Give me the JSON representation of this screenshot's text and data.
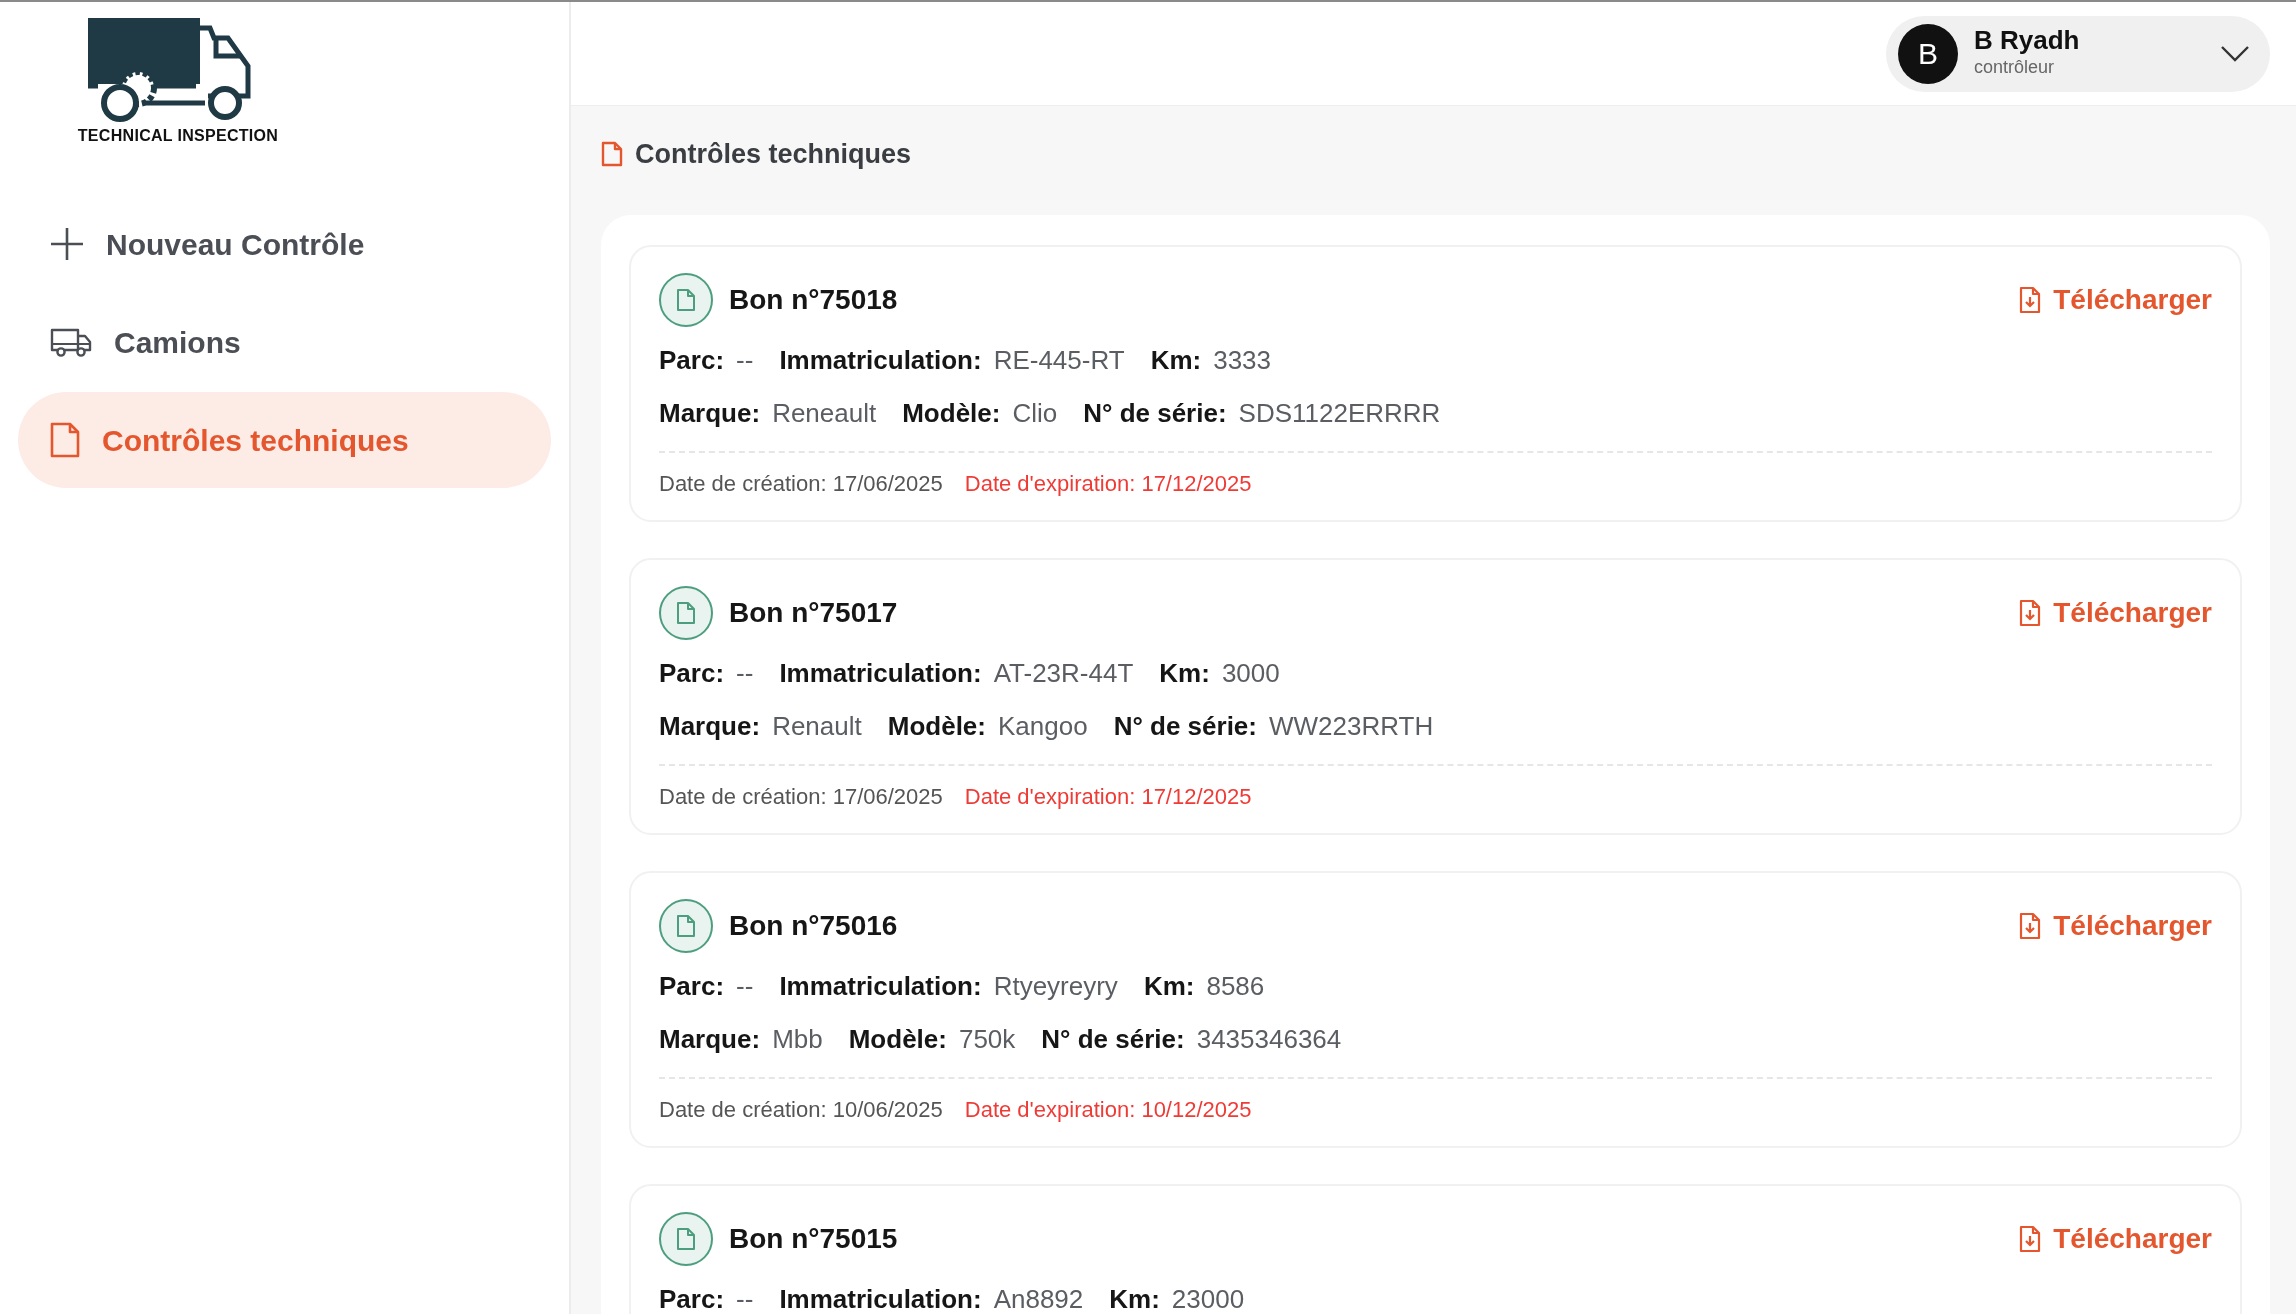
{
  "logo": {
    "text": "TECHNICAL INSPECTION"
  },
  "sidebar": {
    "items": [
      {
        "kind": "plus",
        "label": "Nouveau Contrôle",
        "selected": false
      },
      {
        "kind": "truck",
        "label": "Camions",
        "selected": false
      },
      {
        "kind": "document",
        "label": "Contrôles techniques",
        "selected": true
      }
    ]
  },
  "user": {
    "initial": "B",
    "name": "B Ryadh",
    "role": "contrôleur"
  },
  "page": {
    "title": "Contrôles techniques"
  },
  "bons": [
    {
      "title": "Bon n°75018",
      "download": "Télécharger",
      "rows": [
        [
          {
            "label": "Parc:",
            "value": "--"
          },
          {
            "label": "Immatriculation:",
            "value": "RE-445-RT"
          },
          {
            "label": "Km:",
            "value": "3333"
          }
        ],
        [
          {
            "label": "Marque:",
            "value": "Reneault"
          },
          {
            "label": "Modèle:",
            "value": "Clio"
          },
          {
            "label": "N° de série:",
            "value": "SDS1122ERRRR"
          }
        ]
      ],
      "created": "Date de création: 17/06/2025",
      "expires": "Date d'expiration: 17/12/2025"
    },
    {
      "title": "Bon n°75017",
      "download": "Télécharger",
      "rows": [
        [
          {
            "label": "Parc:",
            "value": "--"
          },
          {
            "label": "Immatriculation:",
            "value": "AT-23R-44T"
          },
          {
            "label": "Km:",
            "value": "3000"
          }
        ],
        [
          {
            "label": "Marque:",
            "value": "Renault"
          },
          {
            "label": "Modèle:",
            "value": "Kangoo"
          },
          {
            "label": "N° de série:",
            "value": "WW223RRTH"
          }
        ]
      ],
      "created": "Date de création: 17/06/2025",
      "expires": "Date d'expiration: 17/12/2025"
    },
    {
      "title": "Bon n°75016",
      "download": "Télécharger",
      "rows": [
        [
          {
            "label": "Parc:",
            "value": "--"
          },
          {
            "label": "Immatriculation:",
            "value": "Rtyeyreyry"
          },
          {
            "label": "Km:",
            "value": "8586"
          }
        ],
        [
          {
            "label": "Marque:",
            "value": "Mbb"
          },
          {
            "label": "Modèle:",
            "value": "750k"
          },
          {
            "label": "N° de série:",
            "value": "3435346364"
          }
        ]
      ],
      "created": "Date de création: 10/06/2025",
      "expires": "Date d'expiration: 10/12/2025"
    },
    {
      "title": "Bon n°75015",
      "download": "Télécharger",
      "rows": [
        [
          {
            "label": "Parc:",
            "value": "--"
          },
          {
            "label": "Immatriculation:",
            "value": "An8892"
          },
          {
            "label": "Km:",
            "value": "23000"
          }
        ]
      ]
    }
  ]
}
